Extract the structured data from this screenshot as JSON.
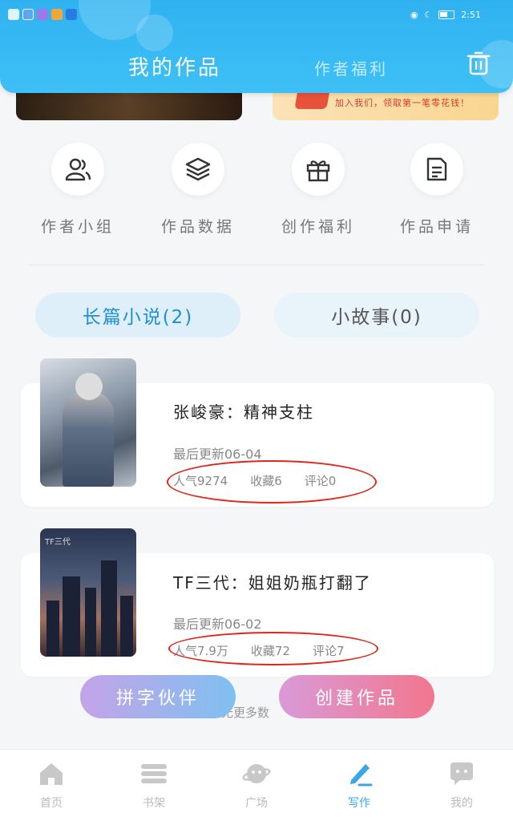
{
  "status_bar": {
    "time": "2:51"
  },
  "header": {
    "tab_active": "我的作品",
    "tab_inactive": "作者福利"
  },
  "banner": {
    "right_text": "加入我们，领取第一笔零花钱！"
  },
  "menu": [
    {
      "label": "作者小组",
      "icon": "author-group-icon"
    },
    {
      "label": "作品数据",
      "icon": "layers-icon"
    },
    {
      "label": "创作福利",
      "icon": "gift-icon"
    },
    {
      "label": "作品申请",
      "icon": "document-icon"
    }
  ],
  "segments": {
    "active": "长篇小说(2)",
    "inactive": "小故事(0)"
  },
  "books": [
    {
      "title": "张峻豪：精神支柱",
      "update": "最后更新06-04",
      "popularity": "人气9274",
      "favorites": "收藏6",
      "comments": "评论0"
    },
    {
      "title": "TF三代：姐姐奶瓶打翻了",
      "update": "最后更新06-02",
      "popularity": "人气7.9万",
      "favorites": "收藏72",
      "comments": "评论7",
      "cover_text": "TF三代"
    }
  ],
  "buttons": {
    "partner": "拼字伙伴",
    "create": "创建作品"
  },
  "no_more": "无更多数",
  "nav": [
    {
      "label": "首页",
      "icon": "home-icon"
    },
    {
      "label": "书架",
      "icon": "bookshelf-icon"
    },
    {
      "label": "广场",
      "icon": "planet-icon"
    },
    {
      "label": "写作",
      "icon": "pen-icon"
    },
    {
      "label": "我的",
      "icon": "chat-icon"
    }
  ],
  "colors": {
    "header": "#3ec0f6",
    "accent": "#1d8fd6",
    "annotation": "#e0261b"
  }
}
